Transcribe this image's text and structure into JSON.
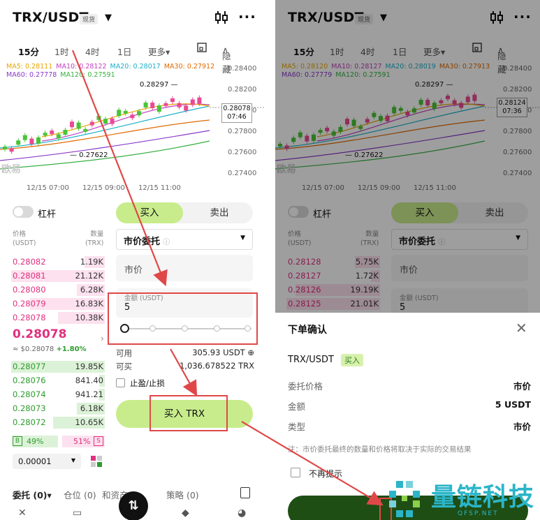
{
  "header": {
    "pair": "TRX/USDT",
    "spot_badge": "现货"
  },
  "timeframes": [
    "15分",
    "1时",
    "4时",
    "1日",
    "更多▾"
  ],
  "hide_label": "隐藏",
  "ma_left": {
    "row1": [
      {
        "label": "MA5: 0.28111",
        "color": "#e8a700"
      },
      {
        "label": "MA10: 0.28122",
        "color": "#c040c0"
      },
      {
        "label": "MA20: 0.28017",
        "color": "#1ab0c8"
      },
      {
        "label": "MA30: 0.27912",
        "color": "#e06a00"
      }
    ],
    "row2": [
      {
        "label": "MA60: 0.27778",
        "color": "#8a39c8"
      },
      {
        "label": "MA120: 0.27591",
        "color": "#36b040"
      }
    ]
  },
  "ma_right": {
    "row1": [
      {
        "label": "MA5: 0.28120",
        "color": "#e8a700"
      },
      {
        "label": "MA10: 0.28127",
        "color": "#c040c0"
      },
      {
        "label": "MA20: 0.28019",
        "color": "#1ab0c8"
      },
      {
        "label": "MA30: 0.27913",
        "color": "#e06a00"
      }
    ],
    "row2": [
      {
        "label": "MA60: 0.27779",
        "color": "#8a39c8"
      },
      {
        "label": "MA120: 0.27591",
        "color": "#36b040"
      }
    ]
  },
  "y_axis": [
    "0.28400",
    "0.28200",
    "0.28000",
    "0.27800",
    "0.27600",
    "0.27400"
  ],
  "x_axis": [
    "12/15 07:00",
    "12/15 09:00",
    "12/15 11:00"
  ],
  "chart_high": "0.28297",
  "chart_low": "0.27622",
  "price_tag_left": {
    "price": "0.28078",
    "time": "07:46"
  },
  "price_tag_right": {
    "price": "0.28124",
    "time": "07:36"
  },
  "watermark": "欧易",
  "leverage_label": "杠杆",
  "orderbook_head": {
    "price": "价格",
    "price_unit": "(USDT)",
    "qty": "数量",
    "qty_unit": "(TRX)"
  },
  "asks_left": [
    {
      "price": "0.28082",
      "qty": "1.19K",
      "depth": 0.22
    },
    {
      "price": "0.28081",
      "qty": "21.12K",
      "depth": 1.0
    },
    {
      "price": "0.28080",
      "qty": "6.28K",
      "depth": 0.3
    },
    {
      "price": "0.28079",
      "qty": "16.83K",
      "depth": 0.8
    },
    {
      "price": "0.28078",
      "qty": "10.38K",
      "depth": 0.5
    }
  ],
  "asks_right": [
    {
      "price": "0.28128",
      "qty": "5.75K",
      "depth": 0.27
    },
    {
      "price": "0.28127",
      "qty": "1.72K",
      "depth": 0.1
    },
    {
      "price": "0.28126",
      "qty": "19.19K",
      "depth": 0.9
    },
    {
      "price": "0.28125",
      "qty": "21.01K",
      "depth": 1.0
    }
  ],
  "last_price": "0.28078",
  "last_sub": "≈ $0.28078",
  "last_change": "+1.80%",
  "bids_left": [
    {
      "price": "0.28077",
      "qty": "19.85K",
      "depth": 1.0
    },
    {
      "price": "0.28076",
      "qty": "841.40",
      "depth": 0.06
    },
    {
      "price": "0.28074",
      "qty": "941.21",
      "depth": 0.07
    },
    {
      "price": "0.28073",
      "qty": "6.18K",
      "depth": 0.3
    },
    {
      "price": "0.28072",
      "qty": "10.65K",
      "depth": 0.55
    }
  ],
  "buy_tab": "买入",
  "sell_tab": "卖出",
  "order_type": "市价委托",
  "market_field": "市价",
  "amount_label": "金额 (USDT)",
  "amount_value": "5",
  "slider_fraction": 0,
  "available_label": "可用",
  "available_value": "305.93 USDT",
  "can_buy_label": "可买",
  "can_buy_value": "1,036.678522 TRX",
  "tpsl_label": "止盈/止损",
  "buy_button": "买入 TRX",
  "b_badge": "B",
  "buy_ratio": "49%",
  "sell_ratio": "51%",
  "s_badge": "S",
  "buy_ratio_value": 0.49,
  "precision": "0.00001",
  "bottom_tabs": [
    "委托 (0)▾",
    "仓位 (0)",
    "和资产",
    "策略 (0)"
  ],
  "modal": {
    "title": "下单确认",
    "pair": "TRX/USDT",
    "side": "买入",
    "rows": [
      {
        "k": "委托价格",
        "v": "市价"
      },
      {
        "k": "金额",
        "v": "5 USDT"
      },
      {
        "k": "类型",
        "v": "市价"
      }
    ],
    "note": "注：市价委托最终的数量和价格将取决于实际的交易结果",
    "no_remind": "不再提示"
  },
  "brand": {
    "name": "量链科技",
    "domain": "QFSP.NET"
  },
  "colors": {
    "buy_green": "#c8ec8c",
    "ask_pink": "#e0307f",
    "bid_green": "#2e9b2e",
    "annotation_red": "#e04848"
  }
}
